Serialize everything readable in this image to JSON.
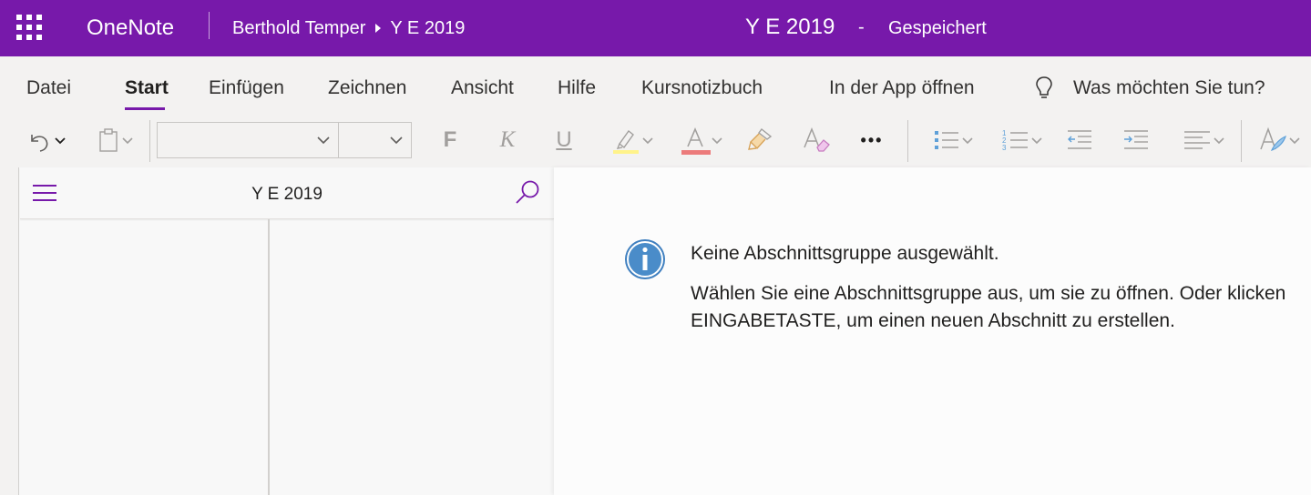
{
  "app": {
    "name": "OneNote"
  },
  "breadcrumb": {
    "owner": "Berthold Temper",
    "notebook": "Y E 2019"
  },
  "document": {
    "title": "Y E 2019",
    "separator": "-",
    "status": "Gespeichert"
  },
  "menu": {
    "tabs": [
      {
        "label": "Datei"
      },
      {
        "label": "Start"
      },
      {
        "label": "Einfügen"
      },
      {
        "label": "Zeichnen"
      },
      {
        "label": "Ansicht"
      },
      {
        "label": "Hilfe"
      },
      {
        "label": "Kursnotizbuch"
      },
      {
        "label": "In der App öffnen"
      }
    ],
    "active_tab": "Start",
    "tell_me": "Was möchten Sie tun?"
  },
  "toolbar": {
    "bold": "F",
    "italic": "K",
    "underline": "U",
    "more": "•••",
    "highlight_color": "#ffe800",
    "font_color": "#e74c3c",
    "icons": [
      "undo-icon",
      "paste-icon",
      "highlight-icon",
      "font-color-icon",
      "format-painter-icon",
      "clear-formatting-icon",
      "bullet-list-icon",
      "numbered-list-icon",
      "decrease-indent-icon",
      "increase-indent-icon",
      "align-icon",
      "styles-icon"
    ]
  },
  "nav": {
    "title": "Y E 2019"
  },
  "message": {
    "title": "Keine Abschnittsgruppe ausgewählt.",
    "line1": "Wählen Sie eine Abschnittsgruppe aus, um sie zu öffnen. Oder klicken",
    "line2": "EINGABETASTE, um einen neuen Abschnitt zu erstellen."
  },
  "colors": {
    "accent": "#7719aa",
    "info": "#3f7fbf"
  }
}
